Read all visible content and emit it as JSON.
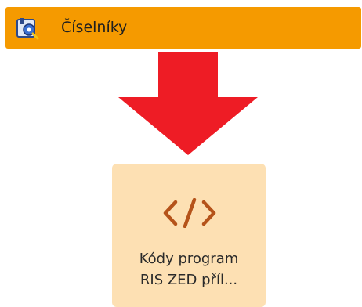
{
  "menu": {
    "label": "Číselníky",
    "icon": "settings-folder-icon",
    "background_color": "#f59a00"
  },
  "arrow": {
    "icon": "arrow-down-icon",
    "color": "#ee1c25"
  },
  "tile": {
    "icon": "code-brackets-icon",
    "icon_color": "#b5531a",
    "label_line1": "Kódy program",
    "label_line2": "RIS ZED příl...",
    "background_color": "#fde0b3"
  }
}
